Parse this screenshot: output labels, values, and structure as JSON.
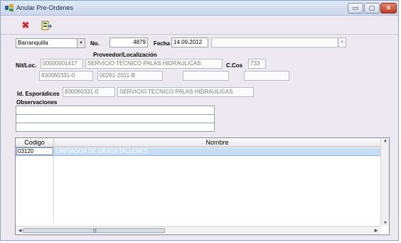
{
  "window": {
    "title": "Anular Pre-Ordenes",
    "controls": {
      "minimize": "▭",
      "maximize": "▢",
      "close": "✕"
    }
  },
  "toolbar": {
    "cancel_icon": "x-icon",
    "export_icon": "export-icon"
  },
  "header": {
    "branch": "Barranquilla",
    "no_label": "No.",
    "no_value": "4879",
    "fecha_label": "Fecha",
    "fecha_value": "14.09.2012",
    "extra_value": ""
  },
  "proveedor": {
    "section_label": "Proveedor/Localización",
    "nit_label": "Nit/Loc.",
    "nit_value": "00000001417",
    "name_value": "SERVICIO TECNICO PALAS HIDRAULICAS",
    "ccos_label": "C.Cos",
    "ccos_value": "733",
    "nit2_value": "830060331-0",
    "code_value": "00261-2011-B",
    "extra1": "",
    "extra2": ""
  },
  "esporadicos": {
    "label": "Id. Esporádicos",
    "id_value": "830060331-0",
    "name_value": "SERVICIO TECNICO PALAS HIDRAULICAS"
  },
  "observaciones": {
    "label": "Observaciones",
    "lines": [
      "",
      "",
      ""
    ]
  },
  "grid": {
    "columns": [
      "Codigo",
      "Nombre"
    ],
    "rows": [
      {
        "codigo": "03120",
        "nombre": "LIMPIADOR DE GRASA TALLERES"
      }
    ],
    "scroll_grip": "|||"
  }
}
